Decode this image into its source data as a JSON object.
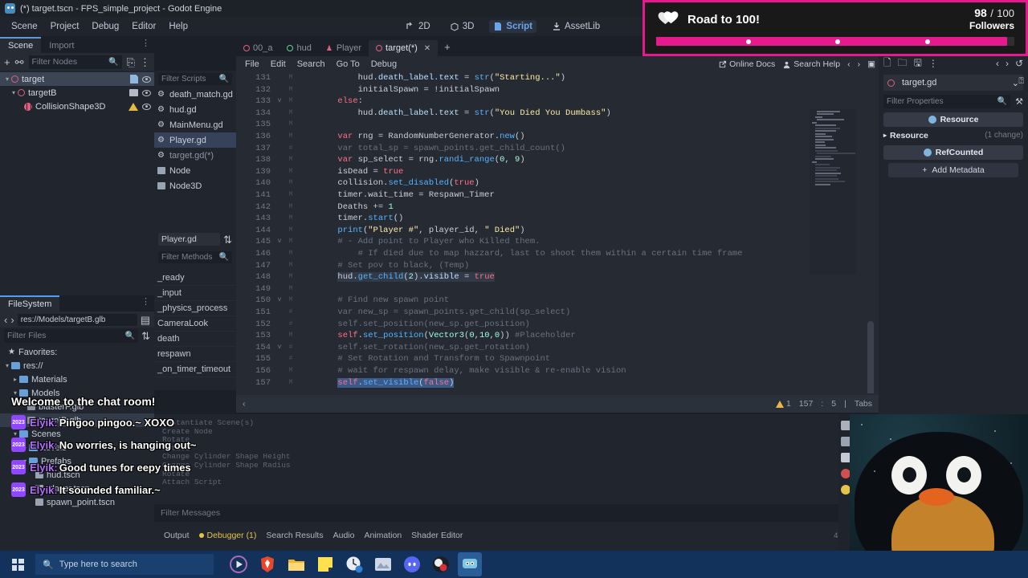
{
  "window": {
    "title": "(*) target.tscn - FPS_simple_project - Godot Engine",
    "logo_icon": "godot-robot-icon"
  },
  "menubar": {
    "items": [
      "Scene",
      "Project",
      "Debug",
      "Editor",
      "Help"
    ]
  },
  "mode_tabs": [
    {
      "label": "2D",
      "icon": "2d-icon",
      "active": false
    },
    {
      "label": "3D",
      "icon": "3d-icon",
      "active": false
    },
    {
      "label": "Script",
      "icon": "script-icon",
      "active": true
    },
    {
      "label": "AssetLib",
      "icon": "assetlib-icon",
      "active": false
    }
  ],
  "scene_panel": {
    "tabs": [
      {
        "label": "Scene",
        "active": true
      },
      {
        "label": "Import",
        "active": false
      }
    ],
    "filter_placeholder": "Filter Nodes",
    "nodes": [
      {
        "label": "target",
        "depth": 0,
        "selected": true,
        "icon": "node3d-icon",
        "right_icons": [
          "script-icon",
          "visibility-icon"
        ]
      },
      {
        "label": "targetB",
        "depth": 1,
        "selected": false,
        "icon": "node3d-icon",
        "right_icons": [
          "scene-icon",
          "visibility-icon"
        ]
      },
      {
        "label": "CollisionShape3D",
        "depth": 2,
        "selected": false,
        "icon": "collision-icon",
        "right_icons": [
          "warning-icon",
          "visibility-icon"
        ]
      }
    ]
  },
  "filesystem_panel": {
    "tab_label": "FileSystem",
    "path": "res://Models/targetB.glb",
    "filter_placeholder": "Filter Files",
    "items": [
      {
        "label": "Favorites:",
        "depth": 0,
        "type": "favorites"
      },
      {
        "label": "res://",
        "depth": 0,
        "type": "folder"
      },
      {
        "label": "Materials",
        "depth": 1,
        "type": "folder"
      },
      {
        "label": "Models",
        "depth": 1,
        "type": "folder"
      },
      {
        "label": "blasterF.glb",
        "depth": 2,
        "type": "file"
      },
      {
        "label": "targetB.glb",
        "depth": 2,
        "type": "file",
        "selected": true
      },
      {
        "label": "Scenes",
        "depth": 1,
        "type": "folder"
      },
      {
        "label": "Levels",
        "depth": 2,
        "type": "folder"
      },
      {
        "label": "Prefabs",
        "depth": 2,
        "type": "folder"
      },
      {
        "label": "hud.tscn",
        "depth": 3,
        "type": "scene"
      },
      {
        "label": "Player.tscn",
        "depth": 3,
        "type": "scene"
      },
      {
        "label": "spawn_point.tscn",
        "depth": 3,
        "type": "scene"
      }
    ]
  },
  "script_list": {
    "filter_placeholder": "Filter Scripts",
    "items": [
      {
        "label": "death_match.gd",
        "icon": "gear-icon",
        "selected": false,
        "dim": false
      },
      {
        "label": "hud.gd",
        "icon": "gear-icon",
        "selected": false,
        "dim": false
      },
      {
        "label": "MainMenu.gd",
        "icon": "gear-icon",
        "selected": false,
        "dim": false
      },
      {
        "label": "Player.gd",
        "icon": "gear-icon",
        "selected": true,
        "dim": false
      },
      {
        "label": "target.gd(*)",
        "icon": "gear-icon",
        "selected": false,
        "dim": true
      },
      {
        "label": "Node",
        "icon": "doc-icon",
        "selected": false,
        "dim": false
      },
      {
        "label": "Node3D",
        "icon": "doc-icon",
        "selected": false,
        "dim": false
      }
    ],
    "current_file": "Player.gd",
    "sort_icon": "sort-icon",
    "methods_filter_placeholder": "Filter Methods",
    "methods": [
      "_ready",
      "_input",
      "_physics_process",
      "CameraLook",
      "death",
      "respawn",
      "_on_timer_timeout"
    ]
  },
  "editor": {
    "tabs": [
      {
        "label": "00_a",
        "icon": "scene-circle-icon",
        "active": false,
        "closable": false
      },
      {
        "label": "hud",
        "icon": "scene-circle-green-icon",
        "active": false,
        "closable": false
      },
      {
        "label": "Player",
        "icon": "player-icon",
        "active": false,
        "closable": false
      },
      {
        "label": "target(*)",
        "icon": "scene-circle-icon",
        "active": true,
        "closable": true
      }
    ],
    "add_tab_label": "+",
    "menu": [
      "File",
      "Edit",
      "Search",
      "Go To",
      "Debug"
    ],
    "toolbar": [
      {
        "label": "Online Docs",
        "icon": "external-link-icon"
      },
      {
        "label": "Search Help",
        "icon": "help-doc-icon"
      }
    ],
    "nav_prev_icon": "chevron-left-icon",
    "nav_next_icon": "chevron-right-icon",
    "panel_icon": "panel-toggle-icon",
    "status": {
      "warning_count": "1",
      "line": "157",
      "column": "5",
      "indent": "Tabs"
    },
    "lines": [
      {
        "num": "131",
        "fold": "",
        "mark": "M",
        "indent": 3,
        "tokens": [
          {
            "t": "hud.",
            "c": ""
          },
          {
            "t": "death_label",
            "c": "v"
          },
          {
            "t": ".",
            "c": ""
          },
          {
            "t": "text",
            "c": "v"
          },
          {
            "t": " = ",
            "c": ""
          },
          {
            "t": "str",
            "c": "f"
          },
          {
            "t": "(",
            "c": ""
          },
          {
            "t": "\"Starting...\"",
            "c": "s"
          },
          {
            "t": ")",
            "c": ""
          }
        ]
      },
      {
        "num": "132",
        "fold": "",
        "mark": "M",
        "indent": 3,
        "tokens": [
          {
            "t": "initialSpawn = !initialSpawn",
            "c": ""
          }
        ]
      },
      {
        "num": "133",
        "fold": "v",
        "mark": "M",
        "indent": 2,
        "tokens": [
          {
            "t": "else",
            "c": "k"
          },
          {
            "t": ":",
            "c": ""
          }
        ]
      },
      {
        "num": "134",
        "fold": "",
        "mark": "M",
        "indent": 3,
        "tokens": [
          {
            "t": "hud.",
            "c": ""
          },
          {
            "t": "death_label",
            "c": "v"
          },
          {
            "t": ".",
            "c": ""
          },
          {
            "t": "text",
            "c": "v"
          },
          {
            "t": " = ",
            "c": ""
          },
          {
            "t": "str",
            "c": "f"
          },
          {
            "t": "(",
            "c": ""
          },
          {
            "t": "\"You Died You Dumbass\"",
            "c": "s"
          },
          {
            "t": ")",
            "c": ""
          }
        ]
      },
      {
        "num": "135",
        "fold": "",
        "mark": "M",
        "indent": 0,
        "tokens": []
      },
      {
        "num": "136",
        "fold": "",
        "mark": "M",
        "indent": 2,
        "tokens": [
          {
            "t": "var",
            "c": "k"
          },
          {
            "t": " rng = RandomNumberGenerator.",
            "c": ""
          },
          {
            "t": "new",
            "c": "f"
          },
          {
            "t": "()",
            "c": ""
          }
        ]
      },
      {
        "num": "137",
        "fold": "",
        "mark": "#",
        "indent": 2,
        "tokens": [
          {
            "t": "var total_sp = spawn_points.get_child_count()",
            "c": "c"
          }
        ]
      },
      {
        "num": "138",
        "fold": "",
        "mark": "M",
        "indent": 2,
        "tokens": [
          {
            "t": "var",
            "c": "k"
          },
          {
            "t": " sp_select = rng.",
            "c": ""
          },
          {
            "t": "randi_range",
            "c": "f"
          },
          {
            "t": "(",
            "c": ""
          },
          {
            "t": "0",
            "c": "n"
          },
          {
            "t": ", ",
            "c": ""
          },
          {
            "t": "9",
            "c": "n"
          },
          {
            "t": ")",
            "c": ""
          }
        ]
      },
      {
        "num": "139",
        "fold": "",
        "mark": "M",
        "indent": 2,
        "tokens": [
          {
            "t": "isDead = ",
            "c": ""
          },
          {
            "t": "true",
            "c": "t"
          }
        ]
      },
      {
        "num": "140",
        "fold": "",
        "mark": "M",
        "indent": 2,
        "tokens": [
          {
            "t": "collision.",
            "c": ""
          },
          {
            "t": "set_disabled",
            "c": "f"
          },
          {
            "t": "(",
            "c": ""
          },
          {
            "t": "true",
            "c": "t"
          },
          {
            "t": ")",
            "c": ""
          }
        ]
      },
      {
        "num": "141",
        "fold": "",
        "mark": "M",
        "indent": 2,
        "tokens": [
          {
            "t": "timer.wait_time = Respawn_Timer",
            "c": ""
          }
        ]
      },
      {
        "num": "142",
        "fold": "",
        "mark": "M",
        "indent": 2,
        "tokens": [
          {
            "t": "Deaths += ",
            "c": ""
          },
          {
            "t": "1",
            "c": "n"
          }
        ]
      },
      {
        "num": "143",
        "fold": "",
        "mark": "M",
        "indent": 2,
        "tokens": [
          {
            "t": "timer.",
            "c": ""
          },
          {
            "t": "start",
            "c": "f"
          },
          {
            "t": "()",
            "c": ""
          }
        ]
      },
      {
        "num": "144",
        "fold": "",
        "mark": "M",
        "indent": 2,
        "tokens": [
          {
            "t": "print",
            "c": "f"
          },
          {
            "t": "(",
            "c": ""
          },
          {
            "t": "\"Player #\"",
            "c": "s"
          },
          {
            "t": ", player_id, ",
            "c": ""
          },
          {
            "t": "\" Died\"",
            "c": "s"
          },
          {
            "t": ")",
            "c": ""
          }
        ]
      },
      {
        "num": "145",
        "fold": "v",
        "mark": "M",
        "indent": 2,
        "tokens": [
          {
            "t": "# - Add point to Player who Killed them.",
            "c": "c"
          }
        ]
      },
      {
        "num": "146",
        "fold": "",
        "mark": "M",
        "indent": 3,
        "tokens": [
          {
            "t": "# If died due to map hazzard, last to shoot them within a certain time frame",
            "c": "c"
          }
        ]
      },
      {
        "num": "147",
        "fold": "",
        "mark": "M",
        "indent": 2,
        "tokens": [
          {
            "t": "# Set pov to black, (Temp)",
            "c": "c"
          }
        ]
      },
      {
        "num": "148",
        "fold": "",
        "mark": "M",
        "indent": 2,
        "highlight": true,
        "tokens": [
          {
            "t": "hud.",
            "c": ""
          },
          {
            "t": "get_child",
            "c": "f"
          },
          {
            "t": "(",
            "c": ""
          },
          {
            "t": "2",
            "c": "n"
          },
          {
            "t": ").",
            "c": ""
          },
          {
            "t": "visible",
            "c": "v"
          },
          {
            "t": " = ",
            "c": ""
          },
          {
            "t": "true",
            "c": "t"
          }
        ]
      },
      {
        "num": "149",
        "fold": "",
        "mark": "M",
        "indent": 0,
        "tokens": []
      },
      {
        "num": "150",
        "fold": "v",
        "mark": "M",
        "indent": 2,
        "tokens": [
          {
            "t": "# Find new spawn point",
            "c": "c"
          }
        ]
      },
      {
        "num": "151",
        "fold": "",
        "mark": "#",
        "indent": 2,
        "tokens": [
          {
            "t": "var new_sp = spawn_points.get_child(sp_select)",
            "c": "c"
          }
        ]
      },
      {
        "num": "152",
        "fold": "",
        "mark": "#",
        "indent": 2,
        "tokens": [
          {
            "t": "self.set_position(new_sp.get_position)",
            "c": "c"
          }
        ]
      },
      {
        "num": "153",
        "fold": "",
        "mark": "M",
        "indent": 2,
        "tokens": [
          {
            "t": "self",
            "c": "k"
          },
          {
            "t": ".",
            "c": ""
          },
          {
            "t": "set_position",
            "c": "f"
          },
          {
            "t": "(",
            "c": ""
          },
          {
            "t": "Vector3",
            "c": "n"
          },
          {
            "t": "(",
            "c": ""
          },
          {
            "t": "0",
            "c": "n"
          },
          {
            "t": ",",
            "c": ""
          },
          {
            "t": "10",
            "c": "n"
          },
          {
            "t": ",",
            "c": ""
          },
          {
            "t": "0",
            "c": "n"
          },
          {
            "t": ")) ",
            "c": ""
          },
          {
            "t": "#Placeholder",
            "c": "c"
          }
        ]
      },
      {
        "num": "154",
        "fold": "v",
        "mark": "#",
        "indent": 2,
        "tokens": [
          {
            "t": "self.set_rotation(new_sp.get_rotation)",
            "c": "c"
          }
        ]
      },
      {
        "num": "155",
        "fold": "",
        "mark": "#",
        "indent": 2,
        "tokens": [
          {
            "t": "# Set Rotation and Transform to Spawnpoint",
            "c": "c"
          }
        ]
      },
      {
        "num": "156",
        "fold": "",
        "mark": "M",
        "indent": 2,
        "tokens": [
          {
            "t": "# wait for respawn delay, make visible & re-enable vision",
            "c": "c"
          }
        ]
      },
      {
        "num": "157",
        "fold": "",
        "mark": "M",
        "indent": 2,
        "selected": true,
        "tokens": [
          {
            "t": "self",
            "c": "k"
          },
          {
            "t": ".",
            "c": ""
          },
          {
            "t": "set_visible",
            "c": "f"
          },
          {
            "t": "(",
            "c": ""
          },
          {
            "t": "false",
            "c": "t"
          },
          {
            "t": ")",
            "c": ""
          }
        ]
      }
    ]
  },
  "inspector": {
    "toolbar_icons": [
      "new-resource-icon",
      "open-resource-icon",
      "save-resource-icon",
      "more-options-icon",
      "history-prev-icon",
      "history-next-icon",
      "history-icon"
    ],
    "resource_name": "target.gd",
    "resource_icon": "script-resource-icon",
    "dropdown_icon": "chevron-down-icon",
    "doc_icon": "open-doc-icon",
    "filter_placeholder": "Filter Properties",
    "tools_icon": "object-tools-icon",
    "category": "Resource",
    "section": "Resource",
    "section_changes": "(1 change)",
    "subcategory": "RefCounted",
    "add_metadata_label": "Add Metadata",
    "add_metadata_icon": "plus-icon"
  },
  "bottom_panel": {
    "debug_history": [
      "Instantiate Scene(s)",
      "Create Node",
      "Rotate",
      "Rotate",
      "Change Cylinder Shape Height",
      "Change Cylinder Shape Radius",
      "Rotate",
      "Attach Script"
    ],
    "filter_placeholder": "Filter Messages",
    "tabs": [
      {
        "label": "Output",
        "active": false,
        "dot": false
      },
      {
        "label": "Debugger (1)",
        "active": true,
        "dot": true
      },
      {
        "label": "Search Results",
        "active": false,
        "dot": false
      },
      {
        "label": "Audio",
        "active": false,
        "dot": false
      },
      {
        "label": "Animation",
        "active": false,
        "dot": false
      },
      {
        "label": "Shader Editor",
        "active": false,
        "dot": false
      }
    ],
    "version": "4.1.1.stabl"
  },
  "goal_overlay": {
    "icon": "heart-icon",
    "title": "Road to 100!",
    "current": "98",
    "separator": "/",
    "max": "100",
    "unit": "Followers",
    "progress_percent": 98,
    "bar_color": "#e7198f",
    "background_color": "#191919",
    "milestones": [
      25,
      50,
      75
    ]
  },
  "chat": {
    "welcome": "Welcome to the chat room!",
    "messages": [
      {
        "badge": "2023",
        "user": "Elyik",
        "sep": ":",
        "text": "Pingoo pingoo.~ XOXO"
      },
      {
        "badge": "2023",
        "user": "Elyik",
        "sep": ":",
        "text": "No worries, is hanging out~"
      },
      {
        "badge": "2023",
        "user": "Elyik",
        "sep": ":",
        "text": "Good tunes for eepy times"
      },
      {
        "badge": "2023",
        "user": "Elyik",
        "sep": ":",
        "text": "It sounded familiar.~"
      }
    ],
    "user_color": "#b76fff"
  },
  "taskbar": {
    "start_icon": "windows-start-icon",
    "search_placeholder": "Type here to search",
    "search_icon": "search-icon",
    "apps": [
      {
        "name": "media-player-icon",
        "active": false
      },
      {
        "name": "brave-browser-icon",
        "active": false
      },
      {
        "name": "file-explorer-icon",
        "active": false
      },
      {
        "name": "sticky-notes-icon",
        "active": false
      },
      {
        "name": "clock-app-icon",
        "active": false
      },
      {
        "name": "photos-icon",
        "active": false
      },
      {
        "name": "discord-icon",
        "active": false
      },
      {
        "name": "obs-studio-icon",
        "active": false
      },
      {
        "name": "godot-engine-icon",
        "active": true
      }
    ]
  }
}
